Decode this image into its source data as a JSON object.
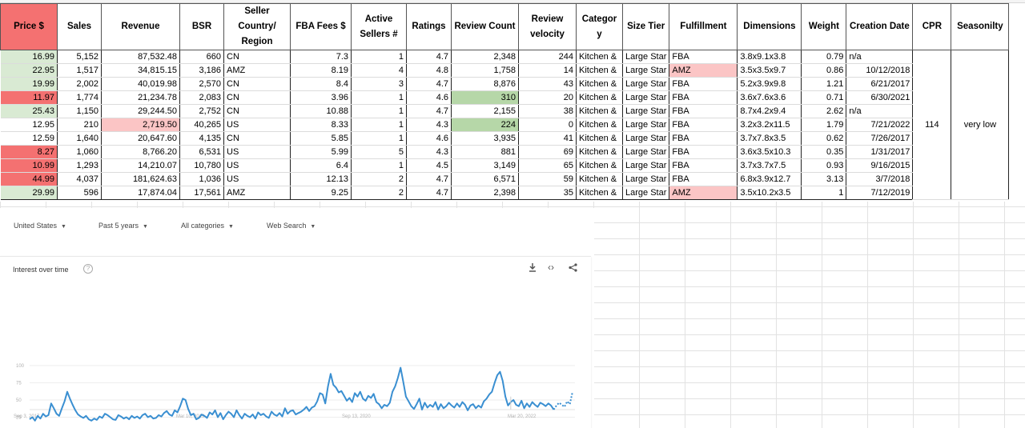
{
  "sheet": {
    "headers": [
      "Price $",
      "Sales",
      "Revenue",
      "BSR",
      "Seller Country/ Region",
      "FBA Fees $",
      "Active Sellers #",
      "Ratings",
      "Review Count",
      "Review velocity",
      "Categor y",
      "Size Tier",
      "Fulfillment",
      "Dimensions",
      "Weight",
      "Creation Date",
      "CPR",
      "Seasonilty"
    ],
    "rows": [
      {
        "price": "16.99",
        "sales": "5,152",
        "revenue": "87,532.48",
        "bsr": "660",
        "country": "CN",
        "fba": "7.3",
        "sellers": "1",
        "ratings": "4.7",
        "reviews": "2,348",
        "velocity": "244",
        "category": "Kitchen &",
        "size": "Large Star",
        "fulfillment": "FBA",
        "dimensions": "3.8x9.1x3.8",
        "weight": "0.79",
        "date": "n/a"
      },
      {
        "price": "22.95",
        "sales": "1,517",
        "revenue": "34,815.15",
        "bsr": "3,186",
        "country": "AMZ",
        "fba": "8.19",
        "sellers": "4",
        "ratings": "4.8",
        "reviews": "1,758",
        "velocity": "14",
        "category": "Kitchen &",
        "size": "Large Star",
        "fulfillment": "AMZ",
        "dimensions": "3.5x3.5x9.7",
        "weight": "0.86",
        "date": "10/12/2018"
      },
      {
        "price": "19.99",
        "sales": "2,002",
        "revenue": "40,019.98",
        "bsr": "2,570",
        "country": "CN",
        "fba": "8.4",
        "sellers": "3",
        "ratings": "4.7",
        "reviews": "8,876",
        "velocity": "43",
        "category": "Kitchen &",
        "size": "Large Star",
        "fulfillment": "FBA",
        "dimensions": "5.2x3.9x9.8",
        "weight": "1.21",
        "date": "6/21/2017"
      },
      {
        "price": "11.97",
        "sales": "1,774",
        "revenue": "21,234.78",
        "bsr": "2,083",
        "country": "CN",
        "fba": "3.96",
        "sellers": "1",
        "ratings": "4.6",
        "reviews": "310",
        "velocity": "20",
        "category": "Kitchen &",
        "size": "Large Star",
        "fulfillment": "FBA",
        "dimensions": "3.6x7.6x3.6",
        "weight": "0.71",
        "date": "6/30/2021"
      },
      {
        "price": "25.43",
        "sales": "1,150",
        "revenue": "29,244.50",
        "bsr": "2,752",
        "country": "CN",
        "fba": "10.88",
        "sellers": "1",
        "ratings": "4.7",
        "reviews": "2,155",
        "velocity": "38",
        "category": "Kitchen &",
        "size": "Large Star",
        "fulfillment": "FBA",
        "dimensions": "8.7x4.2x9.4",
        "weight": "2.62",
        "date": "n/a"
      },
      {
        "price": "12.95",
        "sales": "210",
        "revenue": "2,719.50",
        "bsr": "40,265",
        "country": "US",
        "fba": "8.33",
        "sellers": "1",
        "ratings": "4.3",
        "reviews": "224",
        "velocity": "0",
        "category": "Kitchen &",
        "size": "Large Star",
        "fulfillment": "FBA",
        "dimensions": "3.2x3.2x11.5",
        "weight": "1.79",
        "date": "7/21/2022"
      },
      {
        "price": "12.59",
        "sales": "1,640",
        "revenue": "20,647.60",
        "bsr": "4,135",
        "country": "CN",
        "fba": "5.85",
        "sellers": "1",
        "ratings": "4.6",
        "reviews": "3,935",
        "velocity": "41",
        "category": "Kitchen &",
        "size": "Large Star",
        "fulfillment": "FBA",
        "dimensions": "3.7x7.8x3.5",
        "weight": "0.62",
        "date": "7/26/2017"
      },
      {
        "price": "8.27",
        "sales": "1,060",
        "revenue": "8,766.20",
        "bsr": "6,531",
        "country": "US",
        "fba": "5.99",
        "sellers": "5",
        "ratings": "4.3",
        "reviews": "881",
        "velocity": "69",
        "category": "Kitchen &",
        "size": "Large Star",
        "fulfillment": "FBA",
        "dimensions": "3.6x3.5x10.3",
        "weight": "0.35",
        "date": "1/31/2017"
      },
      {
        "price": "10.99",
        "sales": "1,293",
        "revenue": "14,210.07",
        "bsr": "10,780",
        "country": "US",
        "fba": "6.4",
        "sellers": "1",
        "ratings": "4.5",
        "reviews": "3,149",
        "velocity": "65",
        "category": "Kitchen &",
        "size": "Large Star",
        "fulfillment": "FBA",
        "dimensions": "3.7x3.7x7.5",
        "weight": "0.93",
        "date": "9/16/2015"
      },
      {
        "price": "44.99",
        "sales": "4,037",
        "revenue": "181,624.63",
        "bsr": "1,036",
        "country": "US",
        "fba": "12.13",
        "sellers": "2",
        "ratings": "4.7",
        "reviews": "6,571",
        "velocity": "59",
        "category": "Kitchen &",
        "size": "Large Star",
        "fulfillment": "FBA",
        "dimensions": "6.8x3.9x12.7",
        "weight": "3.13",
        "date": "3/7/2018"
      },
      {
        "price": "29.99",
        "sales": "596",
        "revenue": "17,874.04",
        "bsr": "17,561",
        "country": "AMZ",
        "fba": "9.25",
        "sellers": "2",
        "ratings": "4.7",
        "reviews": "2,398",
        "velocity": "35",
        "category": "Kitchen &",
        "size": "Large Star",
        "fulfillment": "AMZ",
        "dimensions": "3.5x10.2x3.5",
        "weight": "1",
        "date": "7/12/2019"
      }
    ],
    "cpr": "114",
    "seasonality": "very low"
  },
  "colors": {
    "red_strong": "#f47171",
    "red_light": "#fbc5c5",
    "green_light": "#d9ead3",
    "green_mid": "#b6d7a8",
    "line": "#3a8fd1"
  },
  "trends": {
    "filters": {
      "region": "United States",
      "period": "Past 5 years",
      "category": "All categories",
      "search_type": "Web Search"
    },
    "title": "Interest over time",
    "icons": {
      "help": "help-icon",
      "download": "download-icon",
      "embed": "embed-icon",
      "share": "share-icon"
    }
  },
  "chart_data": {
    "type": "line",
    "title": "Interest over time",
    "y_ticks": [
      "100",
      "75",
      "50",
      "25"
    ],
    "x_tick_labels": [
      "Sep 3, 2017",
      "Mar 10, 2019",
      "Sep 13, 2020",
      "Mar 20, 2022"
    ],
    "ylim": [
      0,
      100
    ],
    "grid": true,
    "series": [
      {
        "values": [
          22,
          25,
          20,
          27,
          23,
          30,
          26,
          28,
          45,
          38,
          30,
          27,
          38,
          48,
          62,
          52,
          43,
          35,
          29,
          26,
          24,
          27,
          22,
          20,
          23,
          21,
          26,
          24,
          30,
          28,
          25,
          22,
          21,
          28,
          26,
          23,
          25,
          22,
          27,
          24,
          26,
          23,
          28,
          30,
          25,
          27,
          23,
          24,
          28,
          26,
          31,
          34,
          29,
          27,
          35,
          32,
          41,
          52,
          50,
          37,
          28,
          30,
          22,
          24,
          29,
          27,
          24,
          32,
          29,
          35,
          25,
          31,
          22,
          28,
          33,
          30,
          25,
          35,
          28,
          23,
          30,
          27,
          25,
          29,
          23,
          32,
          28,
          30,
          26,
          24,
          33,
          29,
          27,
          31,
          26,
          38,
          30,
          34,
          35,
          29,
          31,
          33,
          36,
          40,
          34,
          39,
          41,
          48,
          60,
          58,
          45,
          70,
          88,
          72,
          68,
          61,
          63,
          56,
          49,
          53,
          47,
          60,
          55,
          62,
          52,
          49,
          56,
          53,
          59,
          47,
          44,
          38,
          43,
          41,
          46,
          62,
          70,
          82,
          97,
          77,
          55,
          48,
          41,
          37,
          44,
          52,
          36,
          46,
          39,
          43,
          40,
          47,
          36,
          44,
          38,
          41,
          46,
          42,
          39,
          45,
          40,
          47,
          43,
          35,
          42,
          44,
          38,
          42,
          39,
          48,
          52,
          58,
          62,
          75,
          86,
          91,
          78,
          55,
          42,
          47,
          50,
          43,
          41,
          49,
          38,
          45,
          40,
          47,
          43,
          40,
          46,
          44,
          41,
          45,
          42,
          36,
          42,
          46,
          43,
          40,
          48,
          44,
          62
        ]
      }
    ]
  }
}
